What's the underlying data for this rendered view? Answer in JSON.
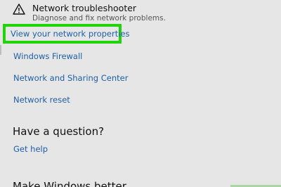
{
  "troubleshooter": {
    "icon": "warning-triangle-icon",
    "title": "Network troubleshooter",
    "description": "Diagnose and fix network problems."
  },
  "links": {
    "network_properties": "View your network properties",
    "windows_firewall": "Windows Firewall",
    "sharing_center": "Network and Sharing Center",
    "network_reset": "Network reset"
  },
  "question": {
    "heading": "Have a question?",
    "help_link": "Get help"
  },
  "feedback": {
    "heading": "Make Windows better"
  },
  "colors": {
    "background": "#e6e6e6",
    "link": "#1e5fa8",
    "highlight": "#22d40a"
  }
}
